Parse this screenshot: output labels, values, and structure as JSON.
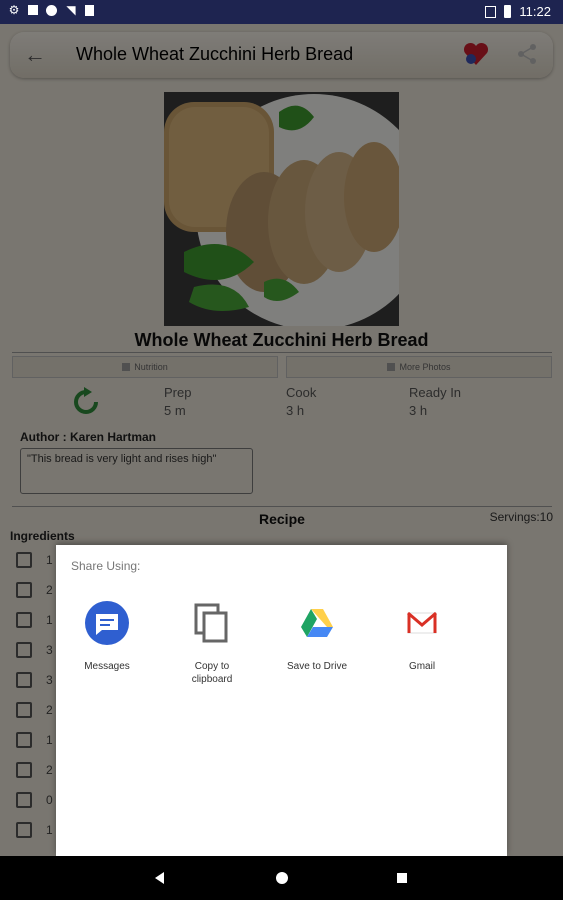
{
  "status_bar": {
    "time": "11:22",
    "icons": [
      "gear-icon",
      "a-icon",
      "circle-icon",
      "signal-icon",
      "sdcard-icon",
      "nosim-icon",
      "battery-icon"
    ]
  },
  "toolbar": {
    "title": "Whole Wheat Zucchini Herb Bread",
    "back_icon": "arrow-left-icon",
    "favorite_icon": "heart-icon",
    "share_icon": "share-icon"
  },
  "recipe": {
    "name": "Whole Wheat Zucchini Herb Bread",
    "buttons": [
      "Nutrition",
      "More Photos"
    ],
    "timings": [
      {
        "label": "Prep",
        "value": "5 m"
      },
      {
        "label": "Cook",
        "value": "3 h"
      },
      {
        "label": "Ready In",
        "value": "3 h"
      }
    ],
    "author": "Author : Karen Hartman",
    "description": "\"This bread is very light and rises high\"",
    "section_label": "Recipe",
    "servings": "Servings:10",
    "ingredients_label": "Ingredients",
    "ingredient_numbers": [
      "1",
      "2",
      "1",
      "3",
      "3",
      "2",
      "1",
      "2",
      "0",
      "1"
    ]
  },
  "share_sheet": {
    "title": "Share Using:",
    "targets": [
      {
        "label": "Messages",
        "icon": "messages-icon"
      },
      {
        "label": "Copy to clipboard",
        "icon": "copy-icon"
      },
      {
        "label": "Save to Drive",
        "icon": "drive-icon"
      },
      {
        "label": "Gmail",
        "icon": "gmail-icon"
      }
    ]
  },
  "colors": {
    "status_bar": "#1e2450",
    "messages_blue": "#2f5fd0",
    "gmail_red": "#d93025",
    "drive_green": "#1fa463",
    "drive_yellow": "#ffd04b",
    "drive_blue": "#4688f4"
  }
}
